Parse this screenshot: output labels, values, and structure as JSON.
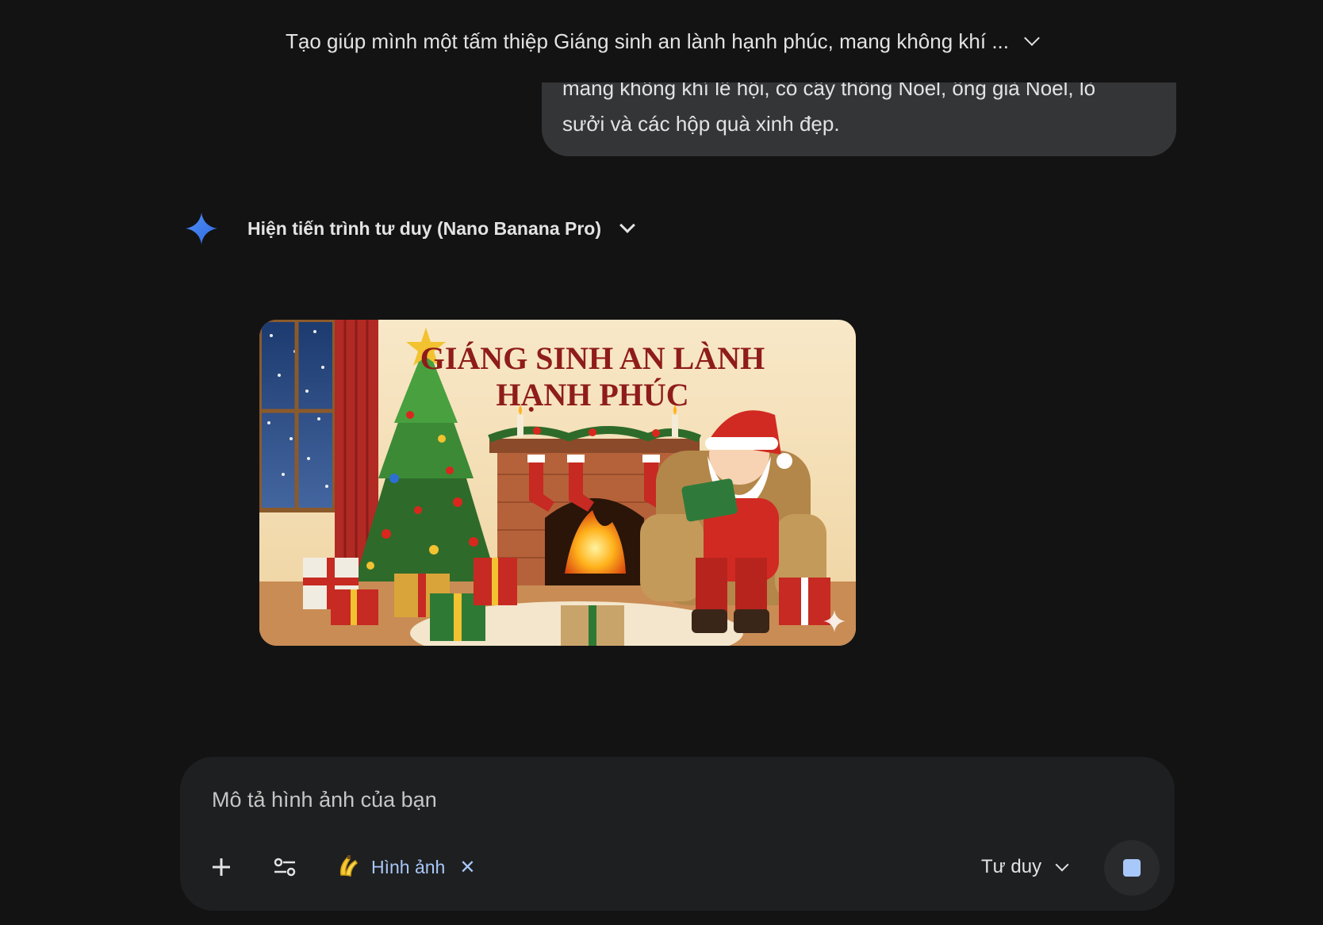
{
  "header": {
    "conversation_title": "Tạo giúp mình một tấm thiệp Giáng sinh an lành hạnh phúc, mang không khí ...",
    "expand_icon": "chevron-down-icon"
  },
  "user_message": {
    "line1": "mang không khí lễ hội, có cây thông Noel, ông già Noel, lò",
    "line2": "sưởi và các hộp quà xinh đẹp."
  },
  "response": {
    "model_icon": "gemini-sparkle-icon",
    "thinking_toggle_label": "Hiện tiến trình tư duy (Nano Banana Pro)",
    "image": {
      "title_line1": "GIÁNG SINH AN LÀNH",
      "title_line2": "HẠNH PHÚC",
      "watermark_icon": "sparkle-icon"
    }
  },
  "composer": {
    "placeholder": "Mô tả hình ảnh của bạn",
    "add_icon": "plus-icon",
    "tools_icon": "sliders-icon",
    "tool_chip": {
      "icon": "banana-icon",
      "label": "Hình ảnh",
      "close": "✕"
    },
    "mode_label": "Tư duy",
    "stop_icon": "stop-icon"
  },
  "colors": {
    "background": "#131314",
    "bubble": "#333537",
    "composer": "#1e1f20",
    "accent": "#a8c7fa"
  }
}
